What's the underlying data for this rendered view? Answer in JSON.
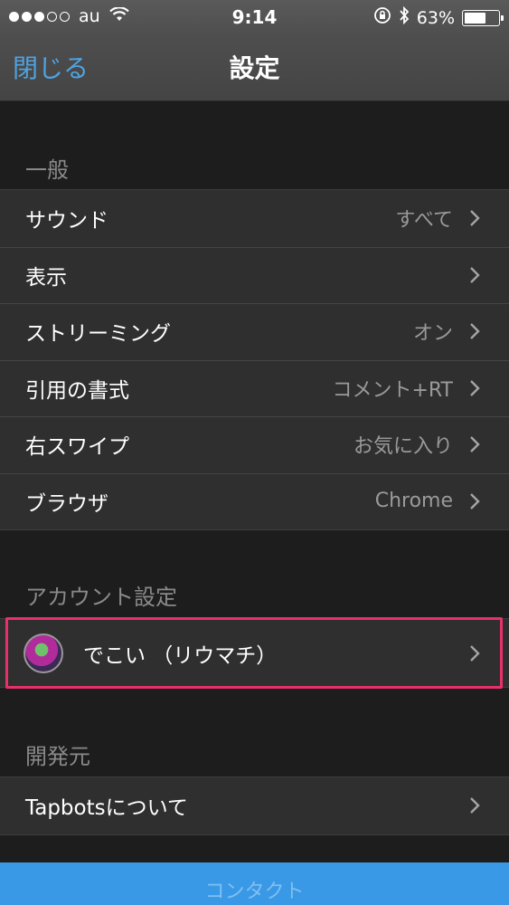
{
  "status_bar": {
    "carrier": "au",
    "time": "9:14",
    "battery_percent_text": "63%",
    "battery_level": 0.63,
    "signal_bars_filled": 3,
    "signal_bars_total": 5,
    "icons": [
      "wifi-icon",
      "orientation-lock-icon",
      "bluetooth-icon",
      "battery-icon"
    ]
  },
  "nav": {
    "close_label": "閉じる",
    "title": "設定"
  },
  "sections": {
    "general": {
      "header": "一般",
      "rows": [
        {
          "label": "サウンド",
          "value": "すべて"
        },
        {
          "label": "表示",
          "value": ""
        },
        {
          "label": "ストリーミング",
          "value": "オン"
        },
        {
          "label": "引用の書式",
          "value": "コメント+RT"
        },
        {
          "label": "右スワイプ",
          "value": "お気に入り"
        },
        {
          "label": "ブラウザ",
          "value": "Chrome"
        }
      ]
    },
    "account": {
      "header": "アカウント設定",
      "account_name": "でこい （リウマチ）"
    },
    "developer": {
      "header": "開発元",
      "rows": [
        {
          "label": "Tapbotsについて"
        }
      ]
    }
  },
  "contact": {
    "label": "コンタクト"
  },
  "colors": {
    "accent": "#4fa3e0",
    "highlight": "#e8306a",
    "contact_bar": "#3a99e6"
  }
}
